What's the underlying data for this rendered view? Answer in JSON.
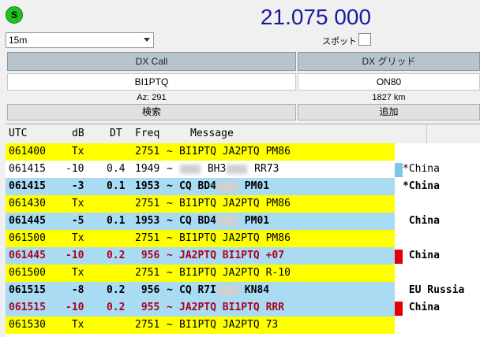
{
  "status": {
    "icon_letter": "S",
    "frequency": "21.075 000"
  },
  "band": {
    "selected": "15m"
  },
  "spot": {
    "label": "スポット"
  },
  "dx": {
    "call_header": "DX Call",
    "grid_header": "DX グリッド",
    "call_value": "BI1PTQ",
    "grid_value": "ON80",
    "azimuth": "Az: 291",
    "distance": "1827 km",
    "lookup_button": "検索",
    "add_button": "追加"
  },
  "columns": {
    "utc": "UTC",
    "db": "dB",
    "dt": "DT",
    "freq": "Freq",
    "message": "Message"
  },
  "colors": {
    "tx_row": "#ffff00",
    "cq_row": "#a9dbf2",
    "to_me_row": "#a9dbf2",
    "to_me_text": "#b00020",
    "marker_red": "#e00000",
    "marker_blue": "#7ec6e8",
    "frequency_text": "#1a1aa0"
  },
  "rows": [
    {
      "utc": "061400",
      "db": "Tx",
      "dt": "",
      "freq": "2751",
      "tilde": "~",
      "msg": [
        "BI1PTQ",
        "JA2PTQ",
        "PM86"
      ],
      "country": "",
      "bg": "#ffff00",
      "fg": "#000000",
      "bold": false,
      "marker": ""
    },
    {
      "utc": "061415",
      "db": "-10",
      "dt": "0.4",
      "freq": "1949",
      "tilde": "~",
      "msg": [
        "",
        "BH3",
        "RR73"
      ],
      "blur": [
        0,
        1
      ],
      "country": "*China",
      "bg": "#ffffff",
      "fg": "#000000",
      "bold": false,
      "marker": "#7ec6e8"
    },
    {
      "utc": "061415",
      "db": "-3",
      "dt": "0.1",
      "freq": "1953",
      "tilde": "~",
      "msg": [
        "CQ",
        "BD4",
        "PM01"
      ],
      "blur": [
        1
      ],
      "country": "*China",
      "bg": "#a9dbf2",
      "fg": "#000000",
      "bold": true,
      "marker": ""
    },
    {
      "utc": "061430",
      "db": "Tx",
      "dt": "",
      "freq": "2751",
      "tilde": "~",
      "msg": [
        "BI1PTQ",
        "JA2PTQ",
        "PM86"
      ],
      "country": "",
      "bg": "#ffff00",
      "fg": "#000000",
      "bold": false,
      "marker": ""
    },
    {
      "utc": "061445",
      "db": "-5",
      "dt": "0.1",
      "freq": "1953",
      "tilde": "~",
      "msg": [
        "CQ",
        "BD4",
        "PM01"
      ],
      "blur": [
        1
      ],
      "country": " China",
      "bg": "#a9dbf2",
      "fg": "#000000",
      "bold": true,
      "marker": ""
    },
    {
      "utc": "061500",
      "db": "Tx",
      "dt": "",
      "freq": "2751",
      "tilde": "~",
      "msg": [
        "BI1PTQ",
        "JA2PTQ",
        "PM86"
      ],
      "country": "",
      "bg": "#ffff00",
      "fg": "#000000",
      "bold": false,
      "marker": ""
    },
    {
      "utc": "061445",
      "db": "-10",
      "dt": "0.2",
      "freq": "956",
      "tilde": "~",
      "msg": [
        "JA2PTQ",
        "BI1PTQ",
        "+07"
      ],
      "country": " China",
      "bg": "#a9dbf2",
      "fg": "#b00020",
      "bold": true,
      "marker": "#e00000"
    },
    {
      "utc": "061500",
      "db": "Tx",
      "dt": "",
      "freq": "2751",
      "tilde": "~",
      "msg": [
        "BI1PTQ",
        "JA2PTQ",
        "R-10"
      ],
      "country": "",
      "bg": "#ffff00",
      "fg": "#000000",
      "bold": false,
      "marker": ""
    },
    {
      "utc": "061515",
      "db": "-8",
      "dt": "0.2",
      "freq": "956",
      "tilde": "~",
      "msg": [
        "CQ",
        "R7I",
        "KN84"
      ],
      "blur": [
        1
      ],
      "country": " EU Russia",
      "bg": "#a9dbf2",
      "fg": "#000000",
      "bold": true,
      "marker": ""
    },
    {
      "utc": "061515",
      "db": "-10",
      "dt": "0.2",
      "freq": "955",
      "tilde": "~",
      "msg": [
        "JA2PTQ",
        "BI1PTQ",
        "RRR"
      ],
      "country": " China",
      "bg": "#a9dbf2",
      "fg": "#b00020",
      "bold": true,
      "marker": "#e00000"
    },
    {
      "utc": "061530",
      "db": "Tx",
      "dt": "",
      "freq": "2751",
      "tilde": "~",
      "msg": [
        "BI1PTQ",
        "JA2PTQ",
        "73"
      ],
      "country": "",
      "bg": "#ffff00",
      "fg": "#000000",
      "bold": false,
      "marker": ""
    }
  ]
}
